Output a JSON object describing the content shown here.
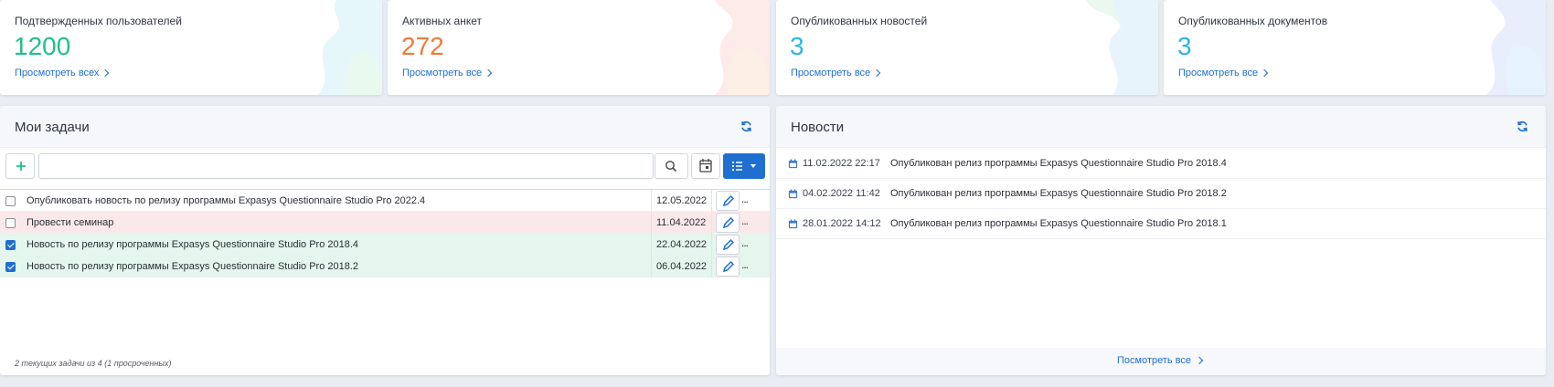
{
  "stats": [
    {
      "label": "Подтвержденных пользователей",
      "value": "1200",
      "link": "Просмотреть всех",
      "color": "#22c08a"
    },
    {
      "label": "Активных анкет",
      "value": "272",
      "link": "Просмотреть все",
      "color": "#f07a3c"
    },
    {
      "label": "Опубликованных новостей",
      "value": "3",
      "link": "Просмотреть все",
      "color": "#29b6e8"
    },
    {
      "label": "Опубликованных документов",
      "value": "3",
      "link": "Просмотреть все",
      "color": "#29b6e8"
    }
  ],
  "tasks": {
    "title": "Мои задачи",
    "search_value": "",
    "rows": [
      {
        "name": "Опубликовать новость по релизу программы Expasys Questionnaire Studio Pro 2022.4",
        "date": "12.05.2022",
        "checked": false,
        "status": "normal"
      },
      {
        "name": "Провести семинар",
        "date": "11.04.2022",
        "checked": false,
        "status": "overdue"
      },
      {
        "name": "Новость по релизу программы Expasys Questionnaire Studio Pro 2018.4",
        "date": "22.04.2022",
        "checked": true,
        "status": "done"
      },
      {
        "name": "Новость по релизу программы Expasys Questionnaire Studio Pro 2018.2",
        "date": "06.04.2022",
        "checked": true,
        "status": "done"
      }
    ],
    "more_label": "...",
    "footer": "2 текущих задачи из 4 (1 просроченных)"
  },
  "news": {
    "title": "Новости",
    "items": [
      {
        "date": "11.02.2022 22:17",
        "title": "Опубликован релиз программы Expasys Questionnaire Studio Pro 2018.4"
      },
      {
        "date": "04.02.2022 11:42",
        "title": "Опубликован релиз программы Expasys Questionnaire Studio Pro 2018.2"
      },
      {
        "date": "28.01.2022 14:12",
        "title": "Опубликован релиз программы Expasys Questionnaire Studio Pro 2018.1"
      }
    ],
    "footer_link": "Посмотреть все"
  },
  "colors": {
    "accent": "#1f6fd1",
    "add": "#22c08a",
    "overdue_row": "#fbe8ea",
    "done_row": "#e4f6ed"
  },
  "icons": {
    "refresh": "refresh-icon",
    "add": "plus-icon",
    "search": "search-icon",
    "calendar": "calendar-icon",
    "list": "list-icon",
    "edit": "pencil-icon"
  }
}
